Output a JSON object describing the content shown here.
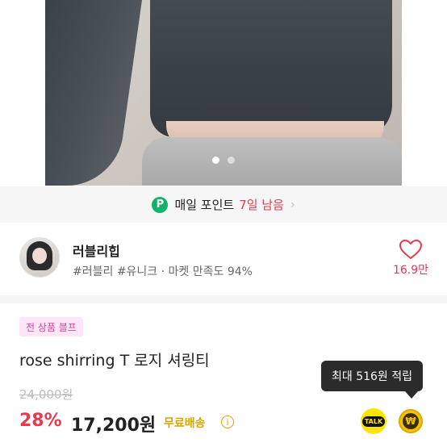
{
  "gallery": {
    "current_index": 1,
    "total": 2
  },
  "points": {
    "badge": "P",
    "label": "매일 포인트",
    "days_left": "7일 남음",
    "chevron": "›"
  },
  "shop": {
    "name": "러블리힙",
    "meta": "#러블리 #유니크 · 마켓 만족도 94%",
    "likes": "16.9만"
  },
  "product": {
    "badge": "전 상품 블프",
    "title": "rose shirring T 로지 셔링티",
    "original_price": "24,000원",
    "discount": "28%",
    "price": "17,200원",
    "shipping": "무료배송",
    "info_glyph": "i"
  },
  "reward": {
    "tooltip": "최대 516원 적립",
    "talk_label": "TALK",
    "won_symbol": "₩"
  },
  "colors": {
    "accent_red": "#e8394f",
    "points_green": "#13b26b",
    "shipping_gold": "#d9a400",
    "badge_pink": "#e83aa5",
    "kakao_yellow": "#fee500"
  }
}
